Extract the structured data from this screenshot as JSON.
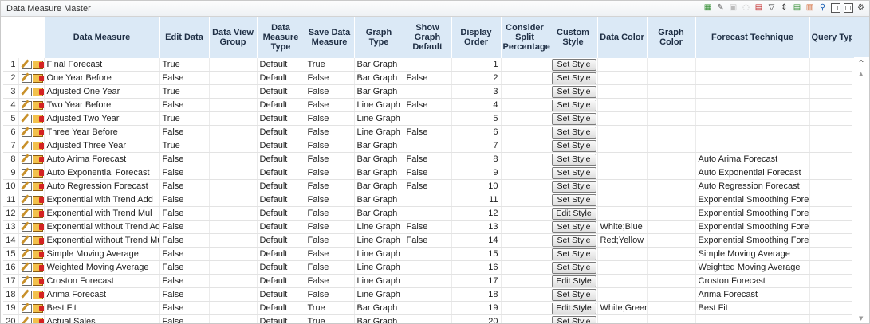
{
  "window": {
    "title": "Data Measure Master"
  },
  "toolbar": {
    "icons": [
      "add-row-icon",
      "edit-icon",
      "save-icon",
      "refresh-icon",
      "delete-icon",
      "filter-icon",
      "sort-icon",
      "export-icon",
      "import-icon",
      "search-icon",
      "copy-icon",
      "restore-icon",
      "settings-icon"
    ]
  },
  "table": {
    "columns": [
      "Data Measure",
      "Edit Data",
      "Data View Group",
      "Data Measure Type",
      "Save Data Measure",
      "Graph Type",
      "Show Graph Default",
      "Display Order",
      "Consider Split Percentage",
      "Custom Style",
      "Data Color",
      "Graph Color",
      "Forecast Technique",
      "Query Typ"
    ],
    "rows": [
      {
        "num": "1",
        "measure": "Final Forecast",
        "edit": "True",
        "group": "",
        "type": "Default",
        "save": "True",
        "graph": "Bar Graph",
        "show": "",
        "order": "1",
        "split": "",
        "style": "Set Style",
        "dcolor": "",
        "gcolor": "",
        "forecast": "",
        "query": ""
      },
      {
        "num": "2",
        "measure": "One Year Before",
        "edit": "False",
        "group": "",
        "type": "Default",
        "save": "False",
        "graph": "Bar Graph",
        "show": "False",
        "order": "2",
        "split": "",
        "style": "Set Style",
        "dcolor": "",
        "gcolor": "",
        "forecast": "",
        "query": ""
      },
      {
        "num": "3",
        "measure": "Adjusted One Year",
        "edit": "True",
        "group": "",
        "type": "Default",
        "save": "False",
        "graph": "Bar Graph",
        "show": "",
        "order": "3",
        "split": "",
        "style": "Set Style",
        "dcolor": "",
        "gcolor": "",
        "forecast": "",
        "query": ""
      },
      {
        "num": "4",
        "measure": "Two Year Before",
        "edit": "False",
        "group": "",
        "type": "Default",
        "save": "False",
        "graph": "Line Graph",
        "show": "False",
        "order": "4",
        "split": "",
        "style": "Set Style",
        "dcolor": "",
        "gcolor": "",
        "forecast": "",
        "query": ""
      },
      {
        "num": "5",
        "measure": "Adjusted Two Year",
        "edit": "True",
        "group": "",
        "type": "Default",
        "save": "False",
        "graph": "Line Graph",
        "show": "",
        "order": "5",
        "split": "",
        "style": "Set Style",
        "dcolor": "",
        "gcolor": "",
        "forecast": "",
        "query": ""
      },
      {
        "num": "6",
        "measure": "Three Year Before",
        "edit": "False",
        "group": "",
        "type": "Default",
        "save": "False",
        "graph": "Line Graph",
        "show": "False",
        "order": "6",
        "split": "",
        "style": "Set Style",
        "dcolor": "",
        "gcolor": "",
        "forecast": "",
        "query": ""
      },
      {
        "num": "7",
        "measure": "Adjusted Three Year",
        "edit": "True",
        "group": "",
        "type": "Default",
        "save": "False",
        "graph": "Bar Graph",
        "show": "",
        "order": "7",
        "split": "",
        "style": "Set Style",
        "dcolor": "",
        "gcolor": "",
        "forecast": "",
        "query": ""
      },
      {
        "num": "8",
        "measure": "Auto Arima Forecast",
        "edit": "False",
        "group": "",
        "type": "Default",
        "save": "False",
        "graph": "Bar Graph",
        "show": "False",
        "order": "8",
        "split": "",
        "style": "Set Style",
        "dcolor": "",
        "gcolor": "",
        "forecast": "Auto Arima Forecast",
        "query": ""
      },
      {
        "num": "9",
        "measure": "Auto Exponential Forecast",
        "edit": "False",
        "group": "",
        "type": "Default",
        "save": "False",
        "graph": "Bar Graph",
        "show": "False",
        "order": "9",
        "split": "",
        "style": "Set Style",
        "dcolor": "",
        "gcolor": "",
        "forecast": "Auto Exponential Forecast",
        "query": ""
      },
      {
        "num": "10",
        "measure": "Auto Regression Forecast",
        "edit": "False",
        "group": "",
        "type": "Default",
        "save": "False",
        "graph": "Bar Graph",
        "show": "False",
        "order": "10",
        "split": "",
        "style": "Set Style",
        "dcolor": "",
        "gcolor": "",
        "forecast": "Auto Regression Forecast",
        "query": ""
      },
      {
        "num": "11",
        "measure": "Exponential with Trend Add",
        "edit": "False",
        "group": "",
        "type": "Default",
        "save": "False",
        "graph": "Bar Graph",
        "show": "",
        "order": "11",
        "split": "",
        "style": "Set Style",
        "dcolor": "",
        "gcolor": "",
        "forecast": "Exponential Smoothing Forecast",
        "query": ""
      },
      {
        "num": "12",
        "measure": "Exponential with Trend Mul",
        "edit": "False",
        "group": "",
        "type": "Default",
        "save": "False",
        "graph": "Bar Graph",
        "show": "",
        "order": "12",
        "split": "",
        "style": "Edit Style",
        "dcolor": "",
        "gcolor": "",
        "forecast": "Exponential Smoothing Forecast",
        "query": ""
      },
      {
        "num": "13",
        "measure": "Exponential without Trend Add",
        "edit": "False",
        "group": "",
        "type": "Default",
        "save": "False",
        "graph": "Line Graph",
        "show": "False",
        "order": "13",
        "split": "",
        "style": "Set Style",
        "dcolor": "White;Blue",
        "gcolor": "",
        "forecast": "Exponential Smoothing Forecast",
        "query": ""
      },
      {
        "num": "14",
        "measure": "Exponential without Trend Mul",
        "edit": "False",
        "group": "",
        "type": "Default",
        "save": "False",
        "graph": "Line Graph",
        "show": "False",
        "order": "14",
        "split": "",
        "style": "Set Style",
        "dcolor": "Red;Yellow",
        "gcolor": "",
        "forecast": "Exponential Smoothing Forecast",
        "query": ""
      },
      {
        "num": "15",
        "measure": "Simple Moving Average",
        "edit": "False",
        "group": "",
        "type": "Default",
        "save": "False",
        "graph": "Line Graph",
        "show": "",
        "order": "15",
        "split": "",
        "style": "Set Style",
        "dcolor": "",
        "gcolor": "",
        "forecast": "Simple Moving Average",
        "query": ""
      },
      {
        "num": "16",
        "measure": "Weighted Moving Average",
        "edit": "False",
        "group": "",
        "type": "Default",
        "save": "False",
        "graph": "Line Graph",
        "show": "",
        "order": "16",
        "split": "",
        "style": "Set Style",
        "dcolor": "",
        "gcolor": "",
        "forecast": "Weighted Moving Average",
        "query": ""
      },
      {
        "num": "17",
        "measure": "Croston Forecast",
        "edit": "False",
        "group": "",
        "type": "Default",
        "save": "False",
        "graph": "Line Graph",
        "show": "",
        "order": "17",
        "split": "",
        "style": "Edit Style",
        "dcolor": "",
        "gcolor": "",
        "forecast": "Croston Forecast",
        "query": ""
      },
      {
        "num": "18",
        "measure": "Arima Forecast",
        "edit": "False",
        "group": "",
        "type": "Default",
        "save": "False",
        "graph": "Line Graph",
        "show": "",
        "order": "18",
        "split": "",
        "style": "Set Style",
        "dcolor": "",
        "gcolor": "",
        "forecast": "Arima Forecast",
        "query": ""
      },
      {
        "num": "19",
        "measure": "Best Fit",
        "edit": "False",
        "group": "",
        "type": "Default",
        "save": "True",
        "graph": "Bar Graph",
        "show": "",
        "order": "19",
        "split": "",
        "style": "Edit Style",
        "dcolor": "White;Green",
        "gcolor": "",
        "forecast": "Best Fit",
        "query": ""
      },
      {
        "num": "20",
        "measure": "Actual Sales",
        "edit": "False",
        "group": "",
        "type": "Default",
        "save": "True",
        "graph": "Bar Graph",
        "show": "",
        "order": "20",
        "split": "",
        "style": "Set Style",
        "dcolor": "",
        "gcolor": "",
        "forecast": "",
        "query": ""
      }
    ]
  },
  "scrollbar": {
    "top_icon": "scroll-to-top-icon",
    "up_icon": "scroll-up-icon",
    "down_icon": "scroll-down-icon"
  }
}
